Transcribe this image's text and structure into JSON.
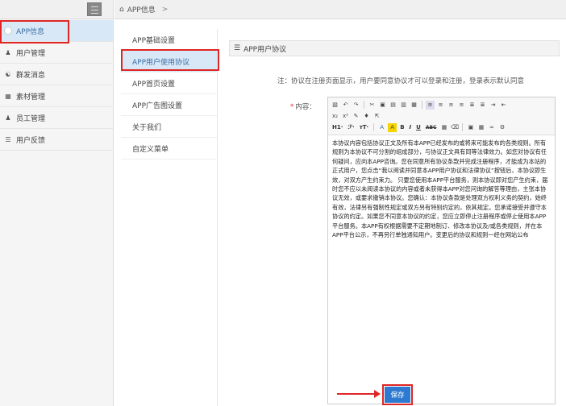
{
  "sidebar": {
    "items": [
      {
        "label": "APP信息",
        "icon": "circle-icon"
      },
      {
        "label": "用户管理",
        "icon": "user-icon"
      },
      {
        "label": "群发消息",
        "icon": "group-icon"
      },
      {
        "label": "素材管理",
        "icon": "image-icon"
      },
      {
        "label": "员工管理",
        "icon": "user-icon"
      },
      {
        "label": "用户反馈",
        "icon": "list-icon"
      }
    ]
  },
  "breadcrumb": {
    "current": "APP信息",
    "separator": ">"
  },
  "subnav": {
    "items": [
      {
        "label": "APP基础设置"
      },
      {
        "label": "APP用户使用协议"
      },
      {
        "label": "APP首页设置"
      },
      {
        "label": "APP广告图设置"
      },
      {
        "label": "关于我们"
      },
      {
        "label": "自定义菜单"
      }
    ]
  },
  "panel": {
    "title": "APP用户协议",
    "notice": "注：协议在注册页面显示，用户要同意协议才可以登录和注册，登录表示默认同意",
    "field_label": "内容：",
    "required_mark": "*",
    "toolbar": {
      "h1": "H1·",
      "font": "ℱ·",
      "size": "тT·",
      "bold": "B",
      "italic": "I",
      "underline": "U",
      "abc": "ABC"
    },
    "content": "本协议内容包括协议正文及所有本APP已经发布的或将来可能发布的各类规则。所有规则为本协议不可分割的组成部分，与协议正文具有同等法律效力。如您对协议有任何疑问，应向本APP咨询。您在同意所有协议条款并完成注册程序，才能成为本站的正式用户，您点击“我以阅读并同意本APP用户协议和法律协议”按钮后，本协议即生效，对双方产生约束力。 只要您使用本APP平台服务，则本协议即对您产生约束，届时您不应以未阅读本协议的内容或者未获得本APP对您问询的解答等理由，主张本协议无效，或要求撤销本协议。您确认：本协议条款是处理双方权利义务的契约，始终有效，法律另有强制性规定或双方另有特别约定的，依其规定。您承诺接受并遵守本协议的约定。如果您不同意本协议的约定，您应立即停止注册程序或停止使用本APP平台服务。本APP有权根据需要不定期地制订、修改本协议及/或各类规则，并在本APP平台公示，不再另行单独通知用户。变更后的协议和规则一经在网站公布",
    "save_label": "保存"
  },
  "colors": {
    "accent": "#2e7ad1",
    "highlight": "#e02525",
    "active_bg": "#d9e8f6"
  }
}
